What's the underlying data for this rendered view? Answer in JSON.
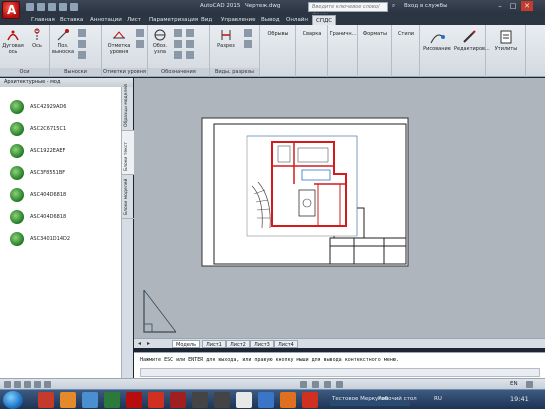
{
  "app": {
    "title": "AutoCAD 2015",
    "file": "Чертеж.dwg",
    "search_placeholder": "Введите ключевое слово/фразу",
    "account_label": "Вход в службы",
    "logo_letter": "A"
  },
  "ribbon_tabs": [
    "Главная",
    "Вставка",
    "Аннотации",
    "Лист",
    "Параметризация",
    "Вид",
    "Управление",
    "Вывод",
    "Онлайн",
    "СПДС"
  ],
  "ribbon_groups": [
    {
      "title": "Оси",
      "buttons": [
        "Дуговая ось",
        "Ось"
      ]
    },
    {
      "title": "Выноски",
      "buttons": [
        "Поз. выноска"
      ]
    },
    {
      "title": "Отметки уровня",
      "buttons": [
        "Отметка уровня"
      ]
    },
    {
      "title": "Обозначения",
      "buttons": [
        "Обоз. узла"
      ]
    },
    {
      "title": "Виды, разрезы",
      "buttons": [
        "Разрез"
      ]
    },
    {
      "title": "",
      "buttons": [
        "Обрывы"
      ]
    },
    {
      "title": "",
      "buttons": [
        "Сварка"
      ]
    },
    {
      "title": "",
      "buttons": [
        "Граничн..."
      ]
    },
    {
      "title": "",
      "buttons": [
        "Форматы"
      ]
    },
    {
      "title": "",
      "buttons": [
        "Стили"
      ]
    },
    {
      "title": "",
      "buttons": [
        "Рисование",
        "Редактиров..."
      ]
    },
    {
      "title": "",
      "buttons": [
        "Утилиты"
      ]
    }
  ],
  "palette": {
    "title": "Архитектурные - мод",
    "items": [
      "ASC42929AD6",
      "ASC2C6715C1",
      "ASC1922EAEF",
      "ASC3F8551BF",
      "ASC404D6818",
      "ASC404D6818",
      "ASC3401D14D2"
    ],
    "side_tabs": [
      "Образцы моделей",
      "Блоки текст",
      "Блоки моделей"
    ]
  },
  "layout_tabs": [
    "Модель",
    "Лист1",
    "Лист2",
    "Лист3",
    "Лист4"
  ],
  "command": {
    "history": "Нажмите ESC или ENTER для выхода, или правую кнопку мыши для вывода контекстного меню.",
    "input": ""
  },
  "status": {
    "input_lang": "EN"
  },
  "taskbar": {
    "desktop_label": "Рабочий стол",
    "lang": "RU",
    "time": "19:41",
    "tray_app": "Тестовое Меркулов"
  },
  "colors": {
    "accent": "#b00f0f",
    "drawing_red": "#d21c1c",
    "plant_green": "#1e7a22"
  }
}
